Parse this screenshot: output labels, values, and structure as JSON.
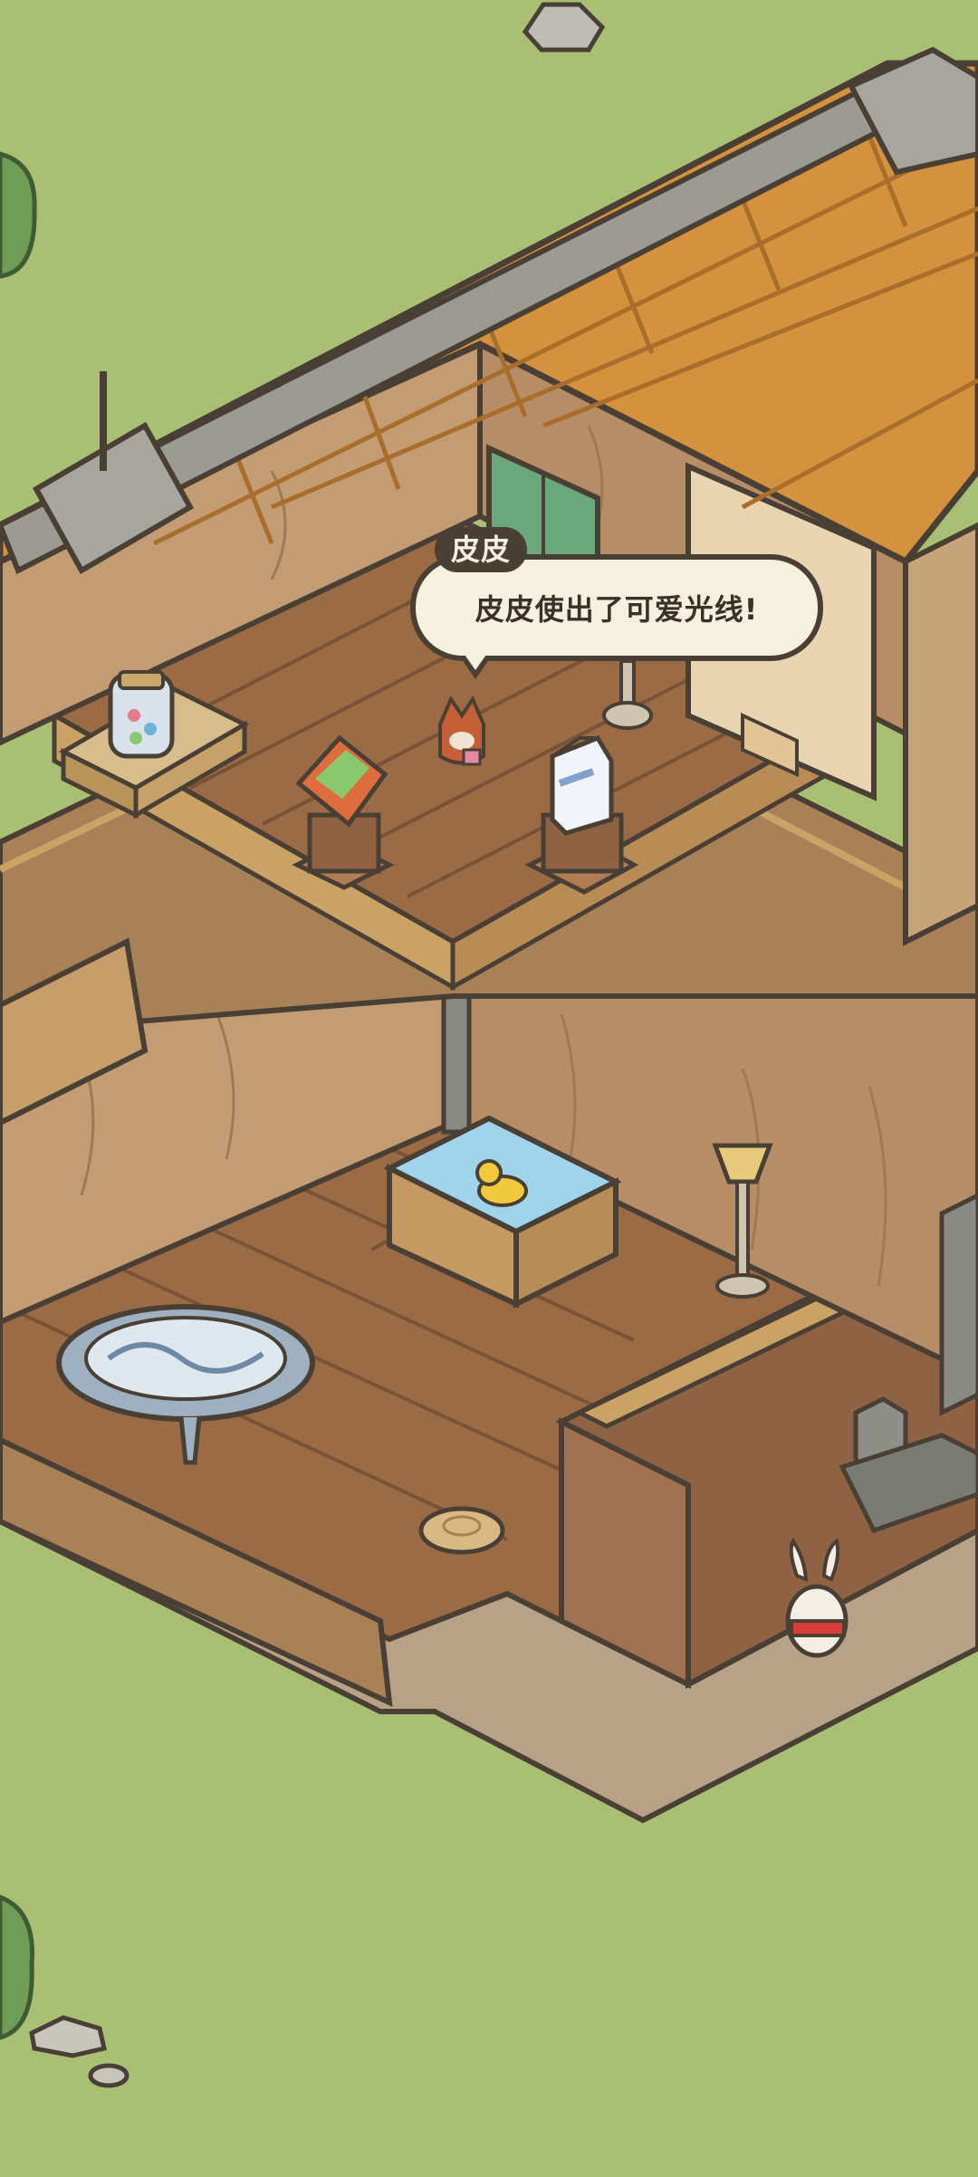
{
  "dialog": {
    "speaker": "皮皮",
    "message": "皮皮使出了可爱光线!"
  },
  "palette": {
    "grass": "#a9bf74",
    "floor": "#9b6b46",
    "wall": "#c49c74",
    "roof": "#d4923e",
    "outline": "#4a3f34"
  },
  "icons": [
    "candy-jar-icon",
    "chips-bag-icon",
    "milk-carton-icon",
    "fox-character",
    "rubber-duck-icon",
    "lamp-icon",
    "rabbit-character",
    "cash-register-icon",
    "stump-stool-icon",
    "round-table-icon",
    "bathtub-icon"
  ]
}
